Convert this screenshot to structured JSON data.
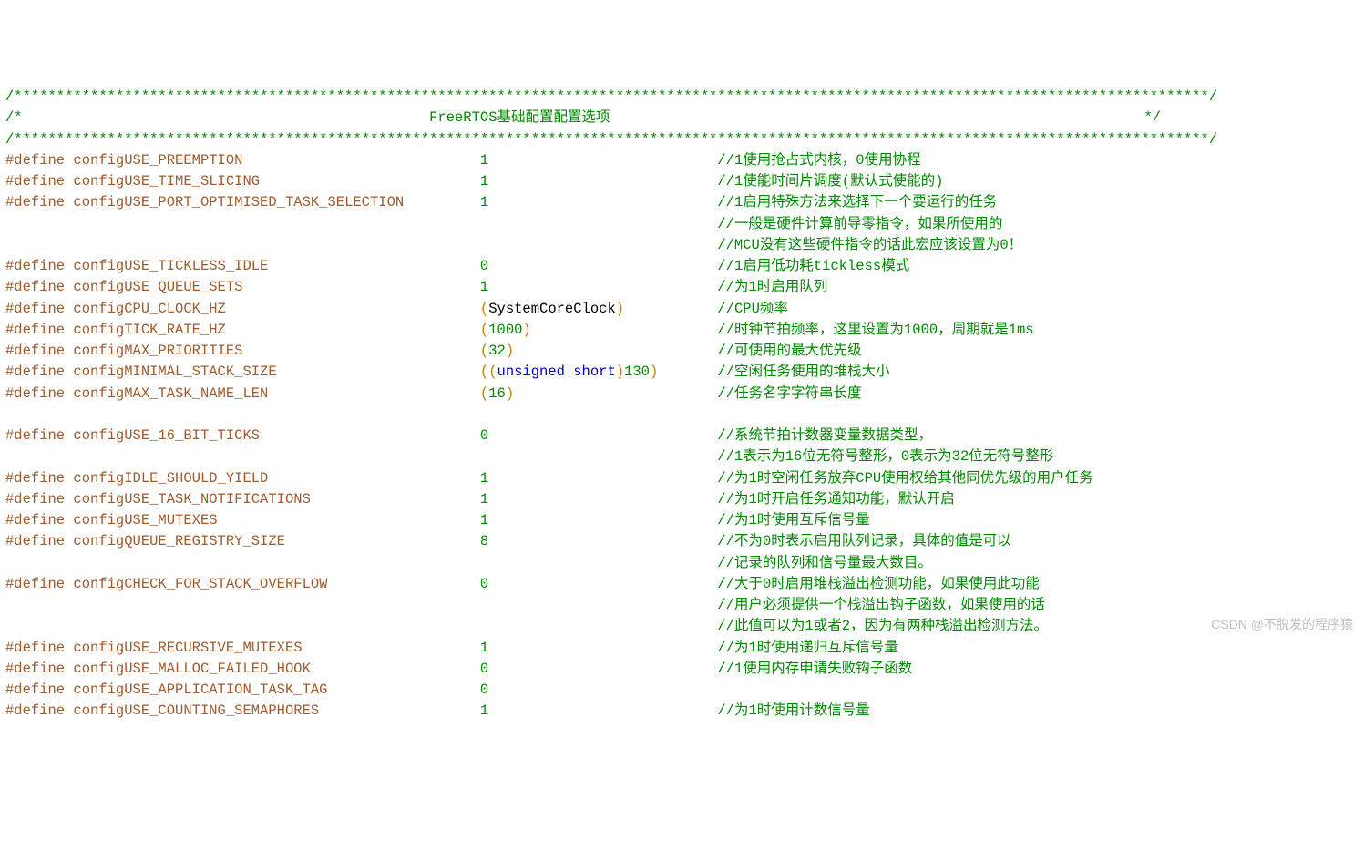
{
  "header": {
    "stars_top": "/*********************************************************************************************************************************************/",
    "title_line_prefix": "/*                                                ",
    "title_text": "FreeRTOS基础配置配置选项",
    "title_line_suffix": "                                                               */",
    "stars_bot": "/*********************************************************************************************************************************************/"
  },
  "col": {
    "define_pad": 6,
    "name_width": 44,
    "value_width": 30
  },
  "lines": [
    {
      "t": "def",
      "name": "configUSE_PREEMPTION",
      "value": "1",
      "comment": "//1使用抢占式内核，0使用协程"
    },
    {
      "t": "def",
      "name": "configUSE_TIME_SLICING",
      "value": "1",
      "comment": "//1使能时间片调度(默认式使能的)"
    },
    {
      "t": "def",
      "name": "configUSE_PORT_OPTIMISED_TASK_SELECTION",
      "value": "1",
      "comment": "//1启用特殊方法来选择下一个要运行的任务"
    },
    {
      "t": "cmt",
      "comment": "//一般是硬件计算前导零指令，如果所使用的"
    },
    {
      "t": "cmt",
      "comment": "//MCU没有这些硬件指令的话此宏应该设置为0！"
    },
    {
      "t": "def",
      "name": "configUSE_TICKLESS_IDLE",
      "value": "0",
      "comment": "//1启用低功耗tickless模式"
    },
    {
      "t": "def",
      "name": "configUSE_QUEUE_SETS",
      "value": "1",
      "comment": "//为1时启用队列"
    },
    {
      "t": "def",
      "name": "configCPU_CLOCK_HZ",
      "value": "(SystemCoreClock)",
      "vkind": "paren-ident",
      "comment": "//CPU频率"
    },
    {
      "t": "def",
      "name": "configTICK_RATE_HZ",
      "value": "(1000)",
      "vkind": "paren-num",
      "comment": "//时钟节拍频率，这里设置为1000，周期就是1ms"
    },
    {
      "t": "def",
      "name": "configMAX_PRIORITIES",
      "value": "(32)",
      "vkind": "paren-num",
      "comment": "//可使用的最大优先级"
    },
    {
      "t": "def",
      "name": "configMINIMAL_STACK_SIZE",
      "value": "((unsigned short)130)",
      "vkind": "cast",
      "comment": "//空闲任务使用的堆栈大小"
    },
    {
      "t": "def",
      "name": "configMAX_TASK_NAME_LEN",
      "value": "(16)",
      "vkind": "paren-num",
      "comment": "//任务名字字符串长度"
    },
    {
      "t": "blank"
    },
    {
      "t": "def",
      "name": "configUSE_16_BIT_TICKS",
      "value": "0",
      "comment": "//系统节拍计数器变量数据类型，"
    },
    {
      "t": "cmt",
      "comment": "//1表示为16位无符号整形，0表示为32位无符号整形"
    },
    {
      "t": "def",
      "name": "configIDLE_SHOULD_YIELD",
      "value": "1",
      "comment": "//为1时空闲任务放弃CPU使用权给其他同优先级的用户任务"
    },
    {
      "t": "def",
      "name": "configUSE_TASK_NOTIFICATIONS",
      "value": "1",
      "comment": "//为1时开启任务通知功能，默认开启"
    },
    {
      "t": "def",
      "name": "configUSE_MUTEXES",
      "value": "1",
      "comment": "//为1时使用互斥信号量"
    },
    {
      "t": "def",
      "name": "configQUEUE_REGISTRY_SIZE",
      "value": "8",
      "comment": "//不为0时表示启用队列记录，具体的值是可以"
    },
    {
      "t": "cmt",
      "comment": "//记录的队列和信号量最大数目。"
    },
    {
      "t": "def",
      "name": "configCHECK_FOR_STACK_OVERFLOW",
      "value": "0",
      "comment": "//大于0时启用堆栈溢出检测功能，如果使用此功能"
    },
    {
      "t": "cmt",
      "comment": "//用户必须提供一个栈溢出钩子函数，如果使用的话"
    },
    {
      "t": "cmt",
      "comment": "//此值可以为1或者2，因为有两种栈溢出检测方法。"
    },
    {
      "t": "def",
      "name": "configUSE_RECURSIVE_MUTEXES",
      "value": "1",
      "comment": "//为1时使用递归互斥信号量"
    },
    {
      "t": "def",
      "name": "configUSE_MALLOC_FAILED_HOOK",
      "value": "0",
      "comment": "//1使用内存申请失败钩子函数"
    },
    {
      "t": "def",
      "name": "configUSE_APPLICATION_TASK_TAG",
      "value": "0",
      "comment": ""
    },
    {
      "t": "def",
      "name": "configUSE_COUNTING_SEMAPHORES",
      "value": "1",
      "comment": "//为1时使用计数信号量"
    }
  ],
  "watermark": "CSDN @不脱发的程序猿"
}
